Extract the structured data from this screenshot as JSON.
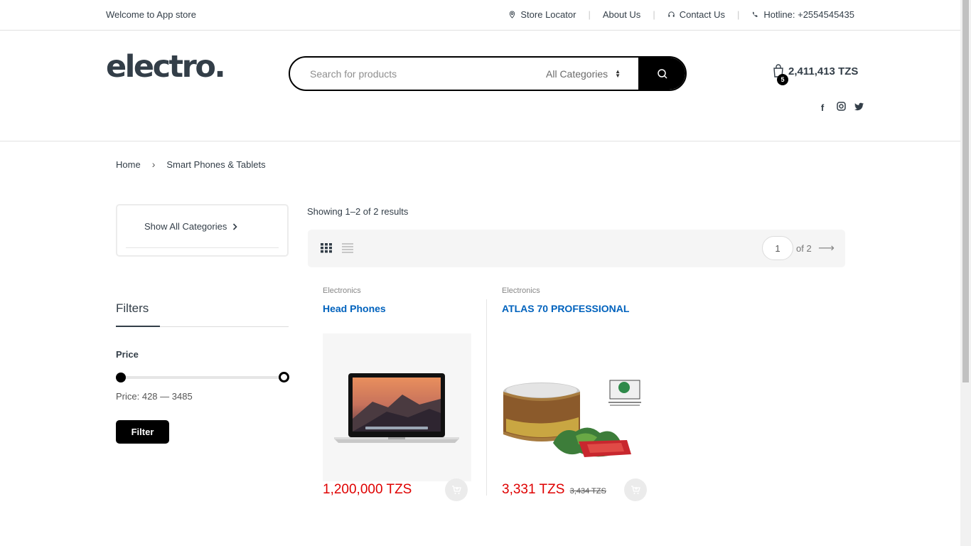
{
  "topbar": {
    "welcome": "Welcome to App store",
    "store_locator": "Store Locator",
    "about_us": "About Us",
    "contact_us": "Contact Us",
    "hotline": "Hotline: +2554545435"
  },
  "header": {
    "logo": "electro",
    "logo_dot": ".",
    "search_placeholder": "Search for products",
    "category_selected": "All Categories",
    "cart_count": "5",
    "cart_total": "2,411,413 TZS",
    "social": [
      "facebook-icon",
      "instagram-icon",
      "twitter-icon"
    ]
  },
  "breadcrumb": {
    "home": "Home",
    "current": "Smart Phones & Tablets"
  },
  "sidebar": {
    "show_all_categories": "Show All Categories",
    "filters_title": "Filters",
    "price_label": "Price",
    "price_range": "Price: 428 — 3485",
    "filter_button": "Filter"
  },
  "results": {
    "count_text": "Showing 1–2 of 2 results",
    "current_page": "1",
    "of_pages": "of 2"
  },
  "products": [
    {
      "category": "Electronics",
      "name": "Head Phones",
      "price": "1,200,000 TZS",
      "old_price": ""
    },
    {
      "category": "Electronics",
      "name": "ATLAS 70 PROFESSIONAL",
      "price": "3,331 TZS",
      "old_price": "3,434 TZS"
    }
  ],
  "colors": {
    "accent": "#000000",
    "link": "#0062bd",
    "price": "#df0000",
    "text": "#333e48"
  }
}
